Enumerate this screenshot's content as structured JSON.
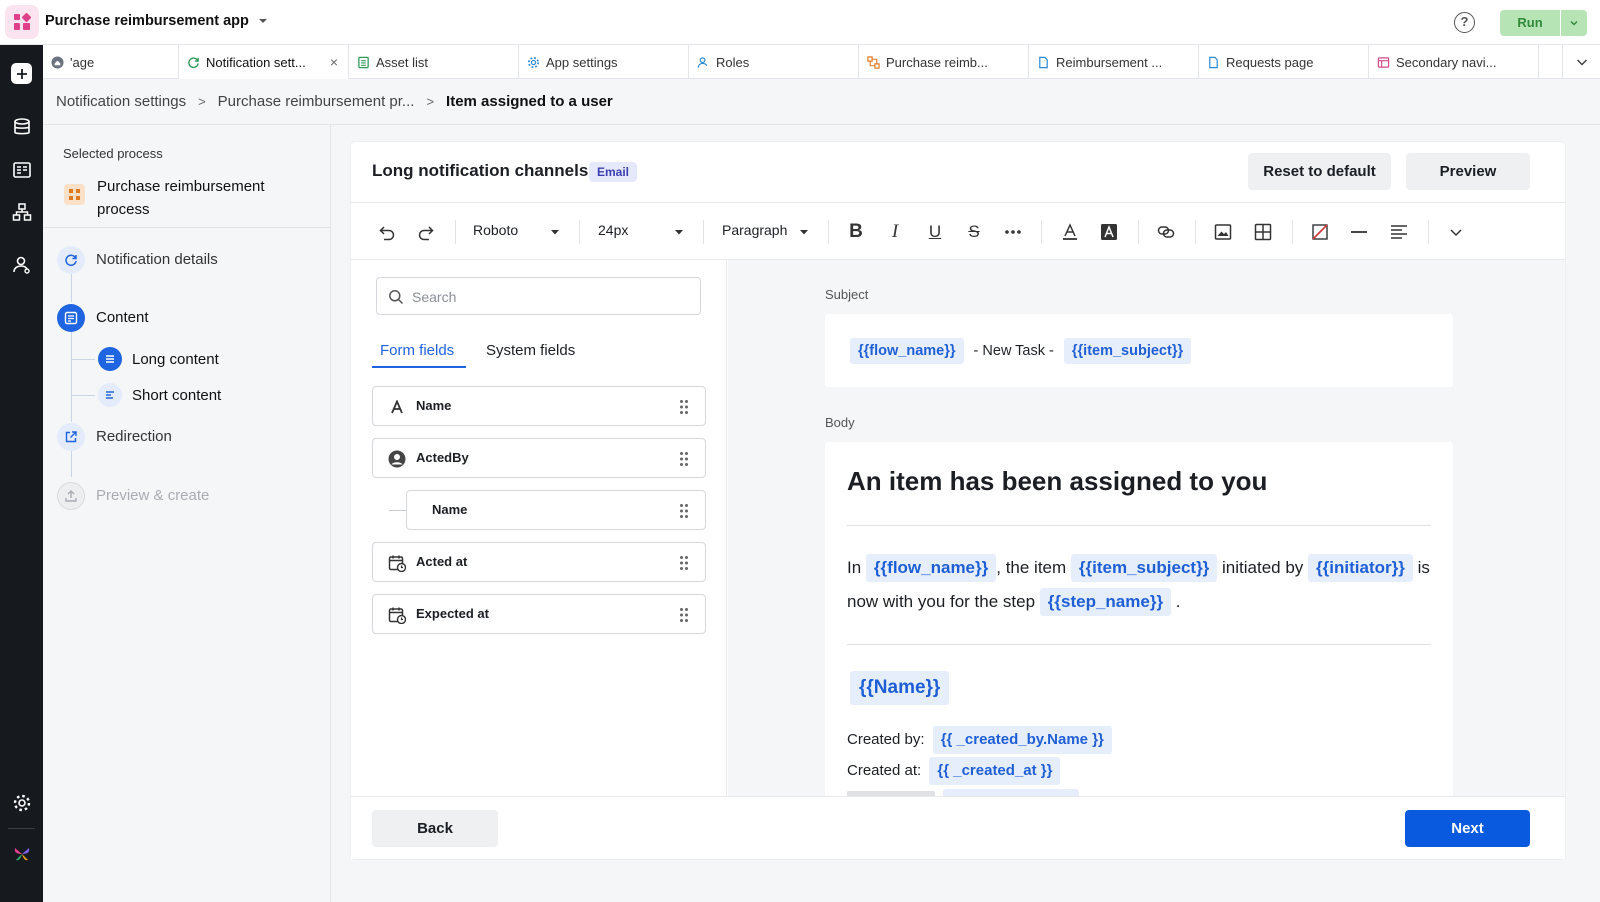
{
  "app": {
    "title": "Purchase reimbursement app",
    "run_label": "Run",
    "help_label": "?"
  },
  "tabs": [
    {
      "label": "'age"
    },
    {
      "label": "Notification sett...",
      "close": "×"
    },
    {
      "label": "Asset list"
    },
    {
      "label": "App settings"
    },
    {
      "label": "Roles"
    },
    {
      "label": "Purchase reimb..."
    },
    {
      "label": "Reimbursement ..."
    },
    {
      "label": "Requests page"
    },
    {
      "label": "Secondary navi..."
    }
  ],
  "breadcrumb": {
    "items": [
      "Notification settings",
      "Purchase reimbursement pr...",
      "Item assigned to a user"
    ],
    "separator": ">"
  },
  "left_panel": {
    "label": "Selected process",
    "process_name": "Purchase reimbursement process",
    "steps": {
      "details": "Notification details",
      "content": "Content",
      "long": "Long content",
      "short": "Short content",
      "redirection": "Redirection",
      "preview": "Preview & create"
    }
  },
  "main": {
    "title": "Long notification channels",
    "badge": "Email",
    "reset_label": "Reset to default",
    "preview_label": "Preview",
    "back_label": "Back",
    "next_label": "Next"
  },
  "toolbar": {
    "font": "Roboto",
    "size": "24px",
    "block": "Paragraph"
  },
  "fields": {
    "search_placeholder": "Search",
    "tab_form": "Form fields",
    "tab_system": "System fields",
    "items": [
      "Name",
      "ActedBy",
      "Name",
      "Acted at",
      "Expected at"
    ]
  },
  "editor": {
    "subject_label": "Subject",
    "subject_tok1": "{{flow_name}}",
    "subject_mid": "- New Task -",
    "subject_tok2": "{{item_subject}}",
    "body_label": "Body",
    "heading": "An item has been assigned to you",
    "p_in": "In",
    "p_tok_flow": "{{flow_name}}",
    "p_item": ", the item",
    "p_tok_item": "{{item_subject}}",
    "p_initiated": "initiated by",
    "p_tok_init": "{{initiator}}",
    "p_now": "is now with you for the step",
    "p_tok_step": "{{step_name}}",
    "p_dot": ".",
    "name_tok": "{{Name}}",
    "created_by_label": "Created by:",
    "created_by_tok": "{{ _created_by.Name }}",
    "created_at_label": "Created at:",
    "created_at_tok": "{{ _created_at }}"
  },
  "colors": {
    "accent": "#0a5ae0",
    "token_bg": "#e6eefb",
    "token_text": "#1f5fd6",
    "run_bg": "#b7e4b5"
  }
}
